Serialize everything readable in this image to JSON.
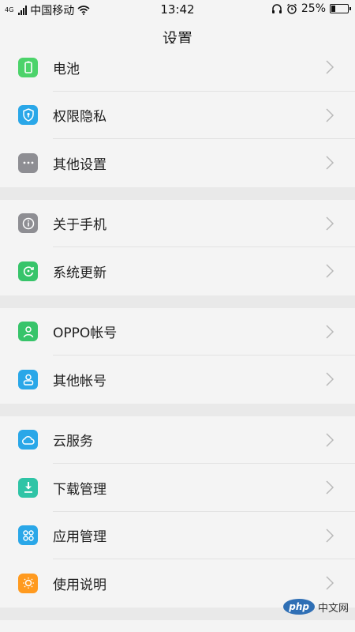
{
  "status_bar": {
    "network_type": "4G",
    "carrier": "中国移动",
    "time": "13:42",
    "battery_percent_text": "25%",
    "battery_level": 0.25
  },
  "header": {
    "title": "设置"
  },
  "groups": [
    {
      "items": [
        {
          "label": "电池",
          "icon": "battery-icon",
          "color": "#4cd36a"
        },
        {
          "label": "权限隐私",
          "icon": "shield-icon",
          "color": "#2aa7e8"
        },
        {
          "label": "其他设置",
          "icon": "more-dots-icon",
          "color": "#8e8e93"
        }
      ]
    },
    {
      "items": [
        {
          "label": "关于手机",
          "icon": "info-icon",
          "color": "#8e8e93"
        },
        {
          "label": "系统更新",
          "icon": "update-icon",
          "color": "#37c46a"
        }
      ]
    },
    {
      "items": [
        {
          "label": "OPPO帐号",
          "icon": "oppo-account-icon",
          "color": "#37c46a"
        },
        {
          "label": "其他帐号",
          "icon": "user-icon",
          "color": "#2aa7e8"
        }
      ]
    },
    {
      "items": [
        {
          "label": "云服务",
          "icon": "cloud-icon",
          "color": "#2aa7e8"
        },
        {
          "label": "下载管理",
          "icon": "download-icon",
          "color": "#2fc4a6"
        },
        {
          "label": "应用管理",
          "icon": "apps-icon",
          "color": "#2aa7e8"
        },
        {
          "label": "使用说明",
          "icon": "bulb-icon",
          "color": "#ff9a1f"
        }
      ]
    }
  ],
  "watermark": {
    "logo_text": "php",
    "site_text": "中文网"
  }
}
